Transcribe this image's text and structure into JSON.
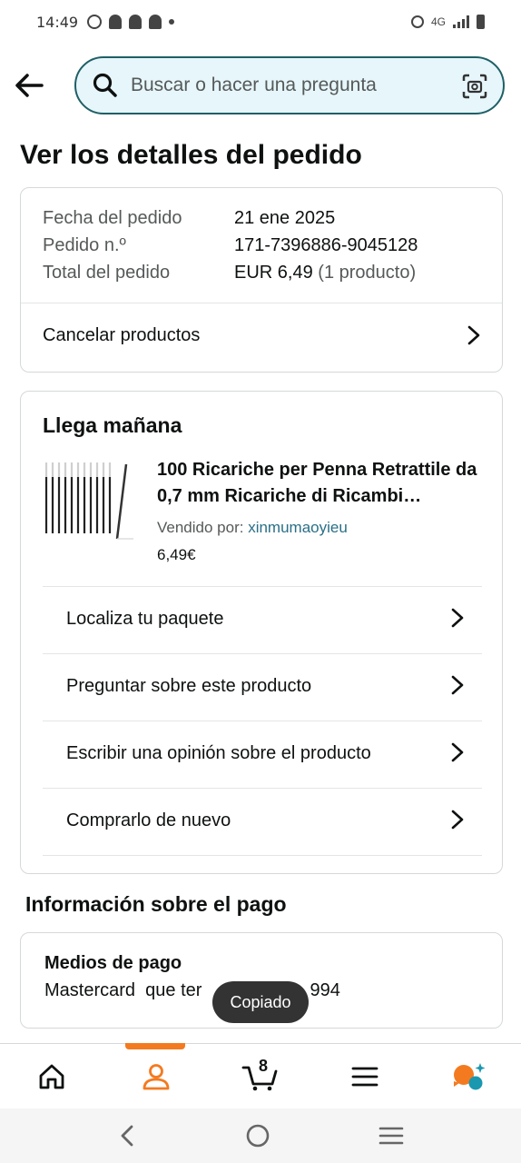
{
  "status_bar": {
    "time": "14:49",
    "network": "4G"
  },
  "search": {
    "placeholder": "Buscar o hacer una pregunta"
  },
  "page": {
    "title": "Ver los detalles del pedido"
  },
  "order_summary": {
    "rows": [
      {
        "label": "Fecha del pedido",
        "value": "21 ene 2025"
      },
      {
        "label": "Pedido n.º",
        "value": "171-7396886-9045128"
      },
      {
        "label": "Total del pedido",
        "value": "EUR 6,49",
        "extra": "(1 producto)"
      }
    ],
    "cancel_label": "Cancelar productos"
  },
  "shipment": {
    "title": "Llega mañana",
    "product": {
      "title": "100 Ricariche per Penna Retrattile da 0,7 mm Ricariche di Ricambi…",
      "seller_prefix": "Vendido por:",
      "seller_name": "xinmumaoyieu",
      "price": "6,49€"
    },
    "actions": [
      "Localiza tu paquete",
      "Preguntar sobre este producto",
      "Escribir una opinión sobre el producto",
      "Comprarlo de nuevo"
    ]
  },
  "payment": {
    "section_title": "Información sobre el pago",
    "method_label": "Medios de pago",
    "method_value_start": "Mastercard  que ter",
    "method_value_end": "994"
  },
  "toast": {
    "text": "Copiado"
  },
  "bottom_nav": {
    "cart_count": "8",
    "active": "account"
  },
  "colors": {
    "accent": "#f47a20",
    "search_border": "#1f5f66",
    "search_bg": "#e6f6fb",
    "link": "#2a6f87"
  }
}
